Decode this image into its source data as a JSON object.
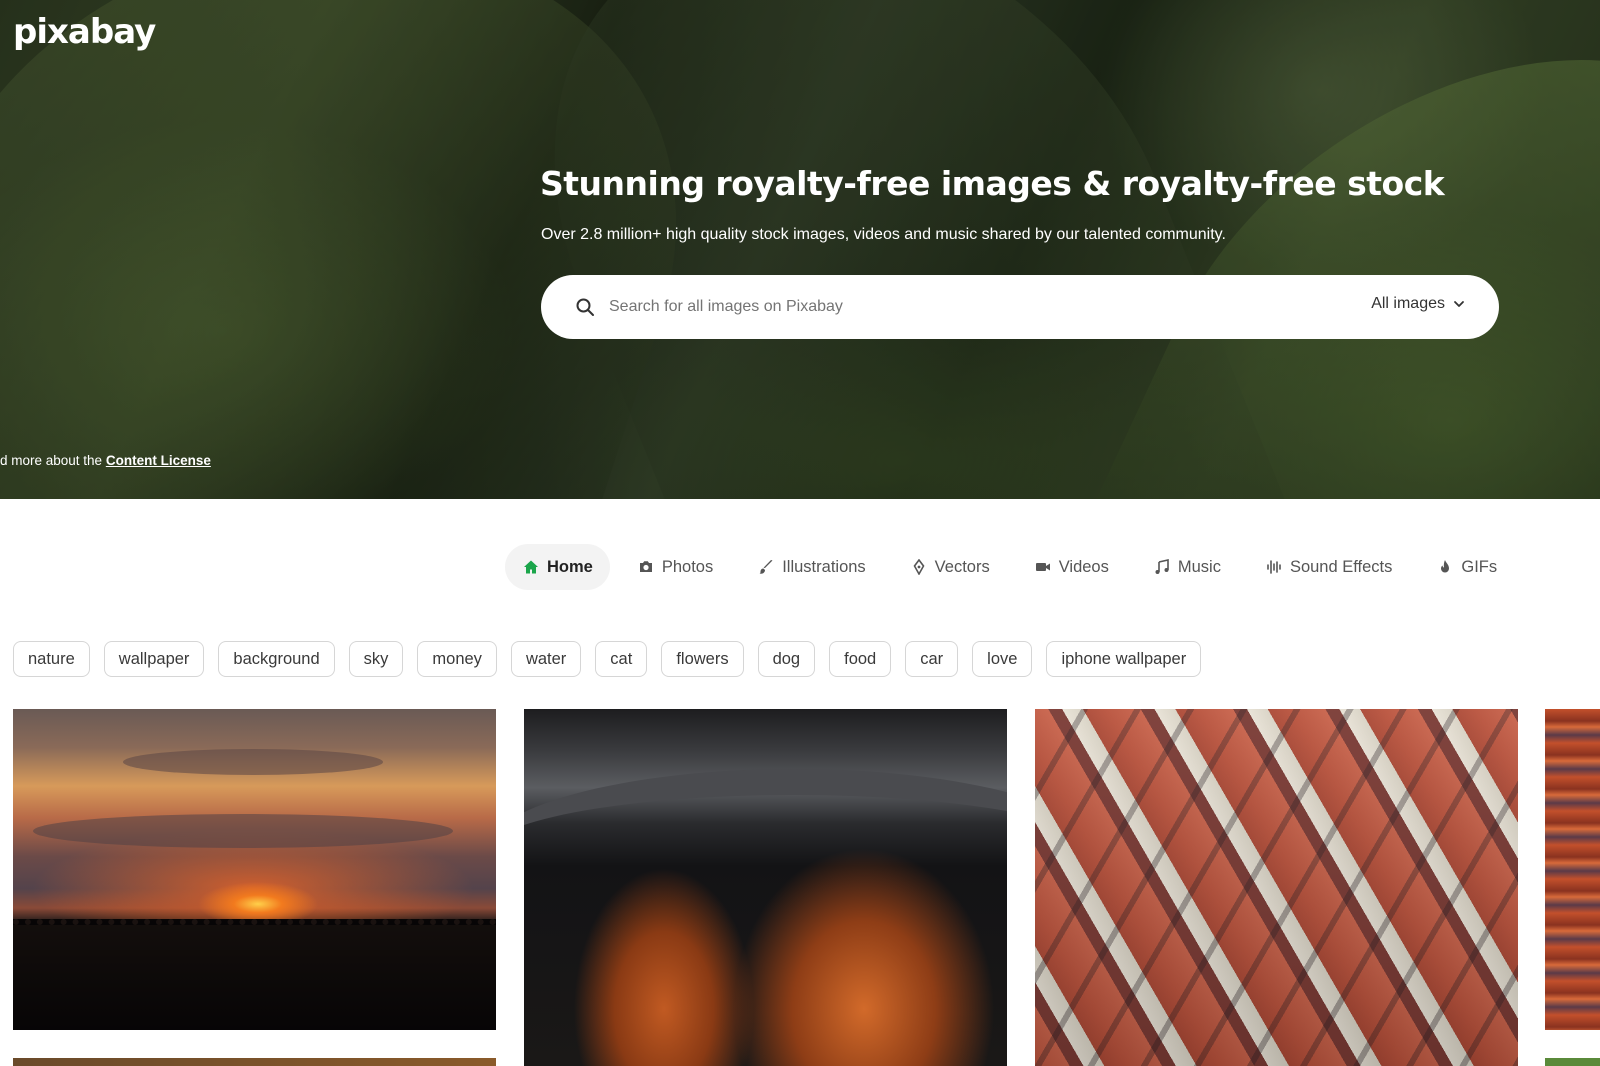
{
  "brand": {
    "logo_text": "pixabay"
  },
  "hero": {
    "title": "Stunning royalty-free images & royalty-free stock",
    "subtitle": "Over 2.8 million+ high quality stock images, videos and music shared by our talented community.",
    "license_prefix": "d more about the ",
    "license_link": "Content License"
  },
  "search": {
    "placeholder": "Search for all images on Pixabay",
    "value": "",
    "scope": "All images"
  },
  "nav": {
    "items": [
      {
        "label": "Home",
        "icon": "home-icon",
        "active": true
      },
      {
        "label": "Photos",
        "icon": "camera-icon",
        "active": false
      },
      {
        "label": "Illustrations",
        "icon": "brush-icon",
        "active": false
      },
      {
        "label": "Vectors",
        "icon": "pen-nib-icon",
        "active": false
      },
      {
        "label": "Videos",
        "icon": "video-camera-icon",
        "active": false
      },
      {
        "label": "Music",
        "icon": "music-note-icon",
        "active": false
      },
      {
        "label": "Sound Effects",
        "icon": "waveform-icon",
        "active": false
      },
      {
        "label": "GIFs",
        "icon": "flame-icon",
        "active": false
      }
    ]
  },
  "tags": [
    "nature",
    "wallpaper",
    "background",
    "sky",
    "money",
    "water",
    "cat",
    "flowers",
    "dog",
    "food",
    "car",
    "love",
    "iphone wallpaper"
  ],
  "colors": {
    "active_home_icon": "#1aa54a",
    "hero_text": "#ffffff",
    "chip_border": "#d6d6d6"
  }
}
